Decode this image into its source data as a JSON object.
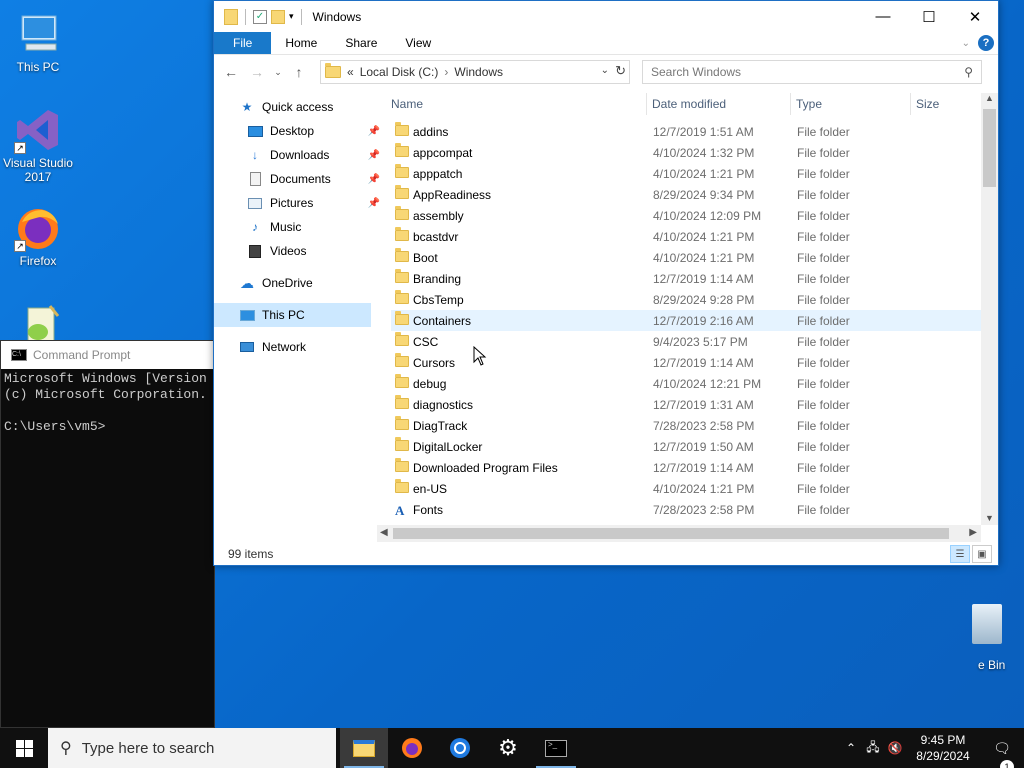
{
  "desktop": {
    "icons": [
      {
        "label": "This PC"
      },
      {
        "label": "Visual Studio 2017"
      },
      {
        "label": "Firefox"
      },
      {
        "label": ""
      }
    ],
    "recycle_bin_label": "e Bin"
  },
  "cmd": {
    "title": "Command Prompt",
    "lines": [
      "Microsoft Windows [Version",
      "(c) Microsoft Corporation.",
      "",
      "C:\\Users\\vm5>"
    ]
  },
  "explorer": {
    "title": "Windows",
    "ribbon_tabs": [
      "File",
      "Home",
      "Share",
      "View"
    ],
    "address": {
      "prefix": "«",
      "crumbs": [
        "Local Disk (C:)",
        "Windows"
      ]
    },
    "search_placeholder": "Search Windows",
    "nav": [
      {
        "label": "Quick access",
        "icon": "star-icon",
        "level": 0
      },
      {
        "label": "Desktop",
        "icon": "desktop-icon",
        "level": 1,
        "pinned": true
      },
      {
        "label": "Downloads",
        "icon": "download-icon",
        "level": 1,
        "pinned": true
      },
      {
        "label": "Documents",
        "icon": "documents-icon",
        "level": 1,
        "pinned": true
      },
      {
        "label": "Pictures",
        "icon": "pictures-icon",
        "level": 1,
        "pinned": true
      },
      {
        "label": "Music",
        "icon": "music-icon",
        "level": 1
      },
      {
        "label": "Videos",
        "icon": "videos-icon",
        "level": 1
      },
      {
        "label": "OneDrive",
        "icon": "cloud-icon",
        "level": 0
      },
      {
        "label": "This PC",
        "icon": "computer-icon",
        "level": 0,
        "selected": true
      },
      {
        "label": "Network",
        "icon": "network-icon",
        "level": 0
      }
    ],
    "columns": [
      "Name",
      "Date modified",
      "Type",
      "Size"
    ],
    "files": [
      {
        "name": "addins",
        "date": "12/7/2019 1:51 AM",
        "type": "File folder"
      },
      {
        "name": "appcompat",
        "date": "4/10/2024 1:32 PM",
        "type": "File folder"
      },
      {
        "name": "apppatch",
        "date": "4/10/2024 1:21 PM",
        "type": "File folder"
      },
      {
        "name": "AppReadiness",
        "date": "8/29/2024 9:34 PM",
        "type": "File folder"
      },
      {
        "name": "assembly",
        "date": "4/10/2024 12:09 PM",
        "type": "File folder"
      },
      {
        "name": "bcastdvr",
        "date": "4/10/2024 1:21 PM",
        "type": "File folder"
      },
      {
        "name": "Boot",
        "date": "4/10/2024 1:21 PM",
        "type": "File folder"
      },
      {
        "name": "Branding",
        "date": "12/7/2019 1:14 AM",
        "type": "File folder"
      },
      {
        "name": "CbsTemp",
        "date": "8/29/2024 9:28 PM",
        "type": "File folder"
      },
      {
        "name": "Containers",
        "date": "12/7/2019 2:16 AM",
        "type": "File folder",
        "hover": true
      },
      {
        "name": "CSC",
        "date": "9/4/2023 5:17 PM",
        "type": "File folder"
      },
      {
        "name": "Cursors",
        "date": "12/7/2019 1:14 AM",
        "type": "File folder"
      },
      {
        "name": "debug",
        "date": "4/10/2024 12:21 PM",
        "type": "File folder"
      },
      {
        "name": "diagnostics",
        "date": "12/7/2019 1:31 AM",
        "type": "File folder"
      },
      {
        "name": "DiagTrack",
        "date": "7/28/2023 2:58 PM",
        "type": "File folder"
      },
      {
        "name": "DigitalLocker",
        "date": "12/7/2019 1:50 AM",
        "type": "File folder"
      },
      {
        "name": "Downloaded Program Files",
        "date": "12/7/2019 1:14 AM",
        "type": "File folder"
      },
      {
        "name": "en-US",
        "date": "4/10/2024 1:21 PM",
        "type": "File folder"
      },
      {
        "name": "Fonts",
        "date": "7/28/2023 2:58 PM",
        "type": "File folder",
        "font_icon": true
      }
    ],
    "status": "99 items"
  },
  "taskbar": {
    "search_placeholder": "Type here to search",
    "apps": [
      "file-explorer-icon",
      "firefox-icon",
      "chrome-icon",
      "settings-icon",
      "terminal-icon"
    ],
    "time": "9:45 PM",
    "date": "8/29/2024",
    "notification_count": "1"
  }
}
